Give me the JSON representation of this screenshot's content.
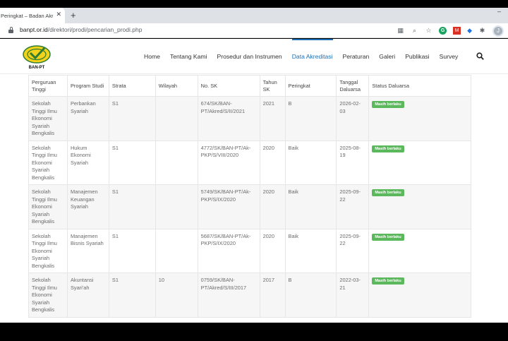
{
  "browser": {
    "tab_title": "Peringkat – Badan Akre",
    "tab_close": "✕",
    "new_tab": "+",
    "minimize": "–",
    "url_host": "banpt.or.id",
    "url_path": "/direktori/prodi/pencarian_prodi.php",
    "ext_g": "G",
    "ext_m": "M",
    "avatar": "J"
  },
  "site": {
    "logo_text": "BAN-PT",
    "nav": [
      "Home",
      "Tentang Kami",
      "Prosedur dan Instrumen",
      "Data Akreditasi",
      "Peraturan",
      "Galeri",
      "Publikasi",
      "Survey"
    ],
    "active_nav": "Data Akreditasi"
  },
  "table": {
    "headers": [
      "Perguruan Tinggi",
      "Program Studi",
      "Strata",
      "Wilayah",
      "No. SK",
      "Tahun SK",
      "Peringkat",
      "Tanggal Daluarsa",
      "Status Daluarsa"
    ],
    "rows": [
      [
        "Sekolah Tinggi Ilmu Ekonomi Syariah Bengkalis",
        "Perbankan Syariah",
        "S1",
        "",
        "674/SK/BAN-PT/Akred/S/II/2021",
        "2021",
        "B",
        "2026-02-03",
        "Masih berlaku"
      ],
      [
        "Sekolah Tinggi Ilmu Ekonomi Syariah Bengkalis",
        "Hukum Ekonomi Syariah",
        "S1",
        "",
        "4772/SK/BAN-PT/Ak-PKP/S/VIII/2020",
        "2020",
        "Baik",
        "2025-08-19",
        "Masih berlaku"
      ],
      [
        "Sekolah Tinggi Ilmu Ekonomi Syariah Bengkalis",
        "Manajemen Keuangan Syariah",
        "S1",
        "",
        "5749/SK/BAN-PT/Ak-PKP/S/IX/2020",
        "2020",
        "Baik",
        "2025-09-22",
        "Masih berlaku"
      ],
      [
        "Sekolah Tinggi Ilmu Ekonomi Syariah Bengkalis",
        "Manajemen Bisnis Syariah",
        "S1",
        "",
        "5687/SK/BAN-PT/Ak-PKP/S/IX/2020",
        "2020",
        "Baik",
        "2025-09-22",
        "Masih berlaku"
      ],
      [
        "Sekolah Tinggi Ilmu Ekonomi Syariah Bengkalis",
        "Akuntansi Syari'ah",
        "S1",
        "10",
        "0759/SK/BAN-PT/Akred/S/III/2017",
        "2017",
        "B",
        "2022-03-21",
        "Masih berlaku"
      ]
    ]
  },
  "colors": {
    "accent": "#1c6fb5",
    "badge": "#5cb85c"
  }
}
